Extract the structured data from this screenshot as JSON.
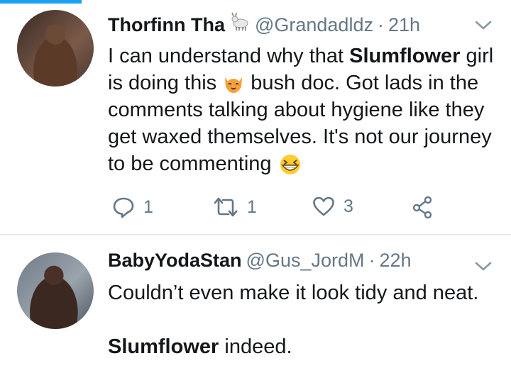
{
  "tweets": [
    {
      "name": "Thorfinn Tha",
      "name_emoji": "goat-emoji",
      "handle": "@Grandadldz",
      "separator": "·",
      "time": "21h",
      "body": {
        "t1": "I can understand why that ",
        "b1": "Slumflower",
        "t2": " girl is doing this ",
        "emoji1": "cat-face-emoji",
        "t3": " bush doc. Got lads in the comments talking about hygiene like they get waxed themselves. It's not our journey to be commenting ",
        "emoji2": "grinning-squinting-face-emoji"
      },
      "actions": {
        "replies": "1",
        "retweets": "1",
        "likes": "3"
      }
    },
    {
      "name": "BabyYodaStan",
      "handle": "@Gus_JordM",
      "separator": "·",
      "time": "22h",
      "body": {
        "line1": "Couldn’t even make it look tidy and neat.",
        "b1": "Slumflower",
        "t2": " indeed."
      }
    }
  ],
  "colors": {
    "accent": "#1da1f2",
    "text": "#14171a",
    "secondary": "#657786",
    "divider": "#e6ecf0"
  }
}
